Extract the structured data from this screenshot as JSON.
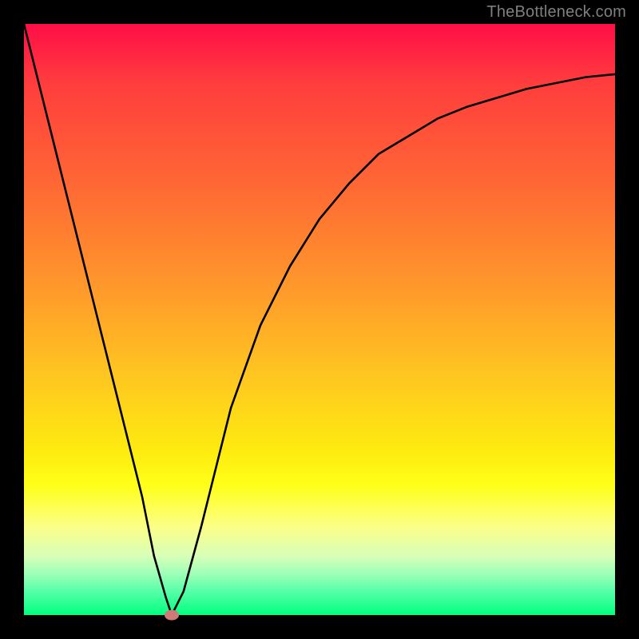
{
  "watermark": "TheBottleneck.com",
  "chart_data": {
    "type": "line",
    "title": "",
    "xlabel": "",
    "ylabel": "",
    "xlim": [
      0,
      100
    ],
    "ylim": [
      0,
      100
    ],
    "grid": false,
    "series": [
      {
        "name": "bottleneck-curve",
        "x": [
          0,
          5,
          10,
          15,
          20,
          22,
          24,
          25,
          27,
          30,
          35,
          40,
          45,
          50,
          55,
          60,
          65,
          70,
          75,
          80,
          85,
          90,
          95,
          100
        ],
        "y": [
          100,
          80,
          60,
          40,
          20,
          10,
          3,
          0,
          4,
          15,
          35,
          49,
          59,
          67,
          73,
          78,
          81,
          84,
          86,
          87.5,
          89,
          90,
          91,
          91.5
        ]
      }
    ],
    "marker": {
      "x": 25,
      "y": 0,
      "color": "#cf7a78"
    },
    "gradient_stops": [
      {
        "pos": 0,
        "color": "#ff0e47"
      },
      {
        "pos": 10,
        "color": "#ff3d3d"
      },
      {
        "pos": 28,
        "color": "#ff6a34"
      },
      {
        "pos": 45,
        "color": "#ff9a2b"
      },
      {
        "pos": 60,
        "color": "#ffc820"
      },
      {
        "pos": 72,
        "color": "#feea10"
      },
      {
        "pos": 78,
        "color": "#ffff18"
      },
      {
        "pos": 85,
        "color": "#fcff86"
      },
      {
        "pos": 90,
        "color": "#d8ffb8"
      },
      {
        "pos": 93,
        "color": "#9effb8"
      },
      {
        "pos": 96,
        "color": "#56ffa8"
      },
      {
        "pos": 100,
        "color": "#00ff7e"
      }
    ]
  }
}
